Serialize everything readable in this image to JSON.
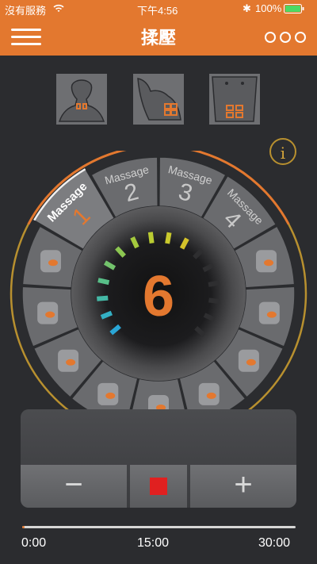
{
  "status_bar": {
    "carrier": "沒有服務",
    "time": "下午4:56",
    "battery": "100%",
    "battery_color": "#4cd964"
  },
  "app_bar": {
    "title": "揉壓",
    "menu_icon": "hamburger-menu-icon",
    "more_icon": "more-options-icon"
  },
  "presets": [
    {
      "name": "neck-shoulder-back"
    },
    {
      "name": "shoulder"
    },
    {
      "name": "abdomen"
    }
  ],
  "info_icon": "i",
  "dial": {
    "intensity": "6",
    "intensity_level_lit": 10,
    "intensity_level_total": 16,
    "modes": [
      {
        "label": "Massage",
        "number": "1",
        "selected": true
      },
      {
        "label": "Massage",
        "number": "2",
        "selected": false
      },
      {
        "label": "Massage",
        "number": "3",
        "selected": false
      },
      {
        "label": "Massage",
        "number": "4",
        "selected": false
      }
    ],
    "body_zones": [
      "buttocks",
      "arm",
      "abdomen",
      "lower-back",
      "back",
      "back-upper",
      "calf",
      "thigh",
      "foot"
    ]
  },
  "controls": {
    "minus": "−",
    "plus": "+",
    "stop_color": "#e02020"
  },
  "timer": {
    "progress": 0.01,
    "start": "0:00",
    "mid": "15:00",
    "end": "30:00"
  },
  "colors": {
    "accent": "#e3782f",
    "gold": "#b8902f"
  }
}
